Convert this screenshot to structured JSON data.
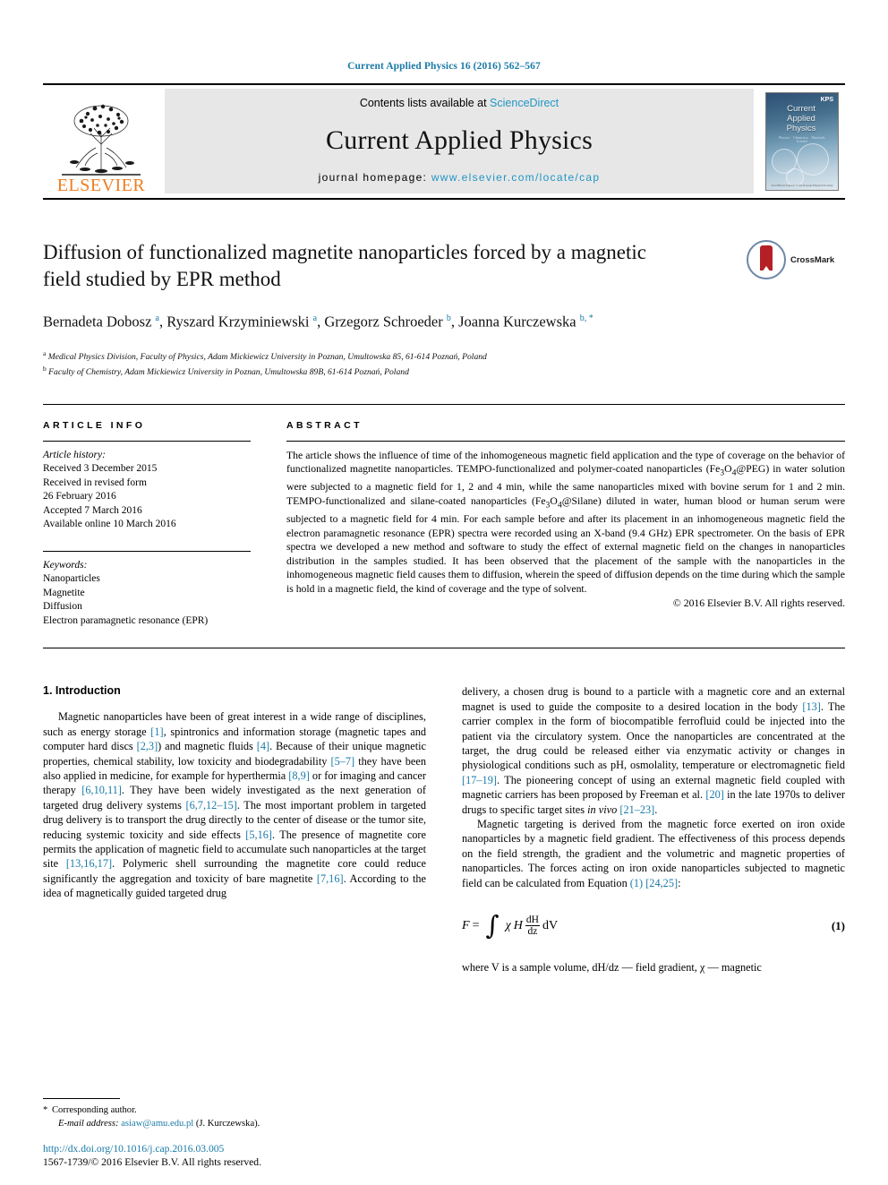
{
  "running_head": "Current Applied Physics 16 (2016) 562–567",
  "banner": {
    "publisher": "ELSEVIER",
    "contents_prefix": "Contents lists available at ",
    "contents_link": "ScienceDirect",
    "journal_name": "Current Applied Physics",
    "homepage_prefix": "journal homepage: ",
    "homepage_url": "www.elsevier.com/locate/cap",
    "cover": {
      "title_line1": "Current",
      "title_line2": "Applied",
      "title_line3": "Physics",
      "subtitle": "Physics · Chemistry · Materials Science",
      "society": "KPS",
      "footer": "An Official Journal of the Korean Physical Society"
    }
  },
  "article": {
    "title": "Diffusion of functionalized magnetite nanoparticles forced by a magnetic field studied by EPR method",
    "crossmark_label": "CrossMark",
    "authors_html": "Bernadeta Dobosz <sup>a</sup>, Ryszard Krzyminiewski <sup>a</sup>, Grzegorz Schroeder <sup>b</sup>, Joanna Kurczewska <sup>b, *</sup>",
    "affiliations": [
      "Medical Physics Division, Faculty of Physics, Adam Mickiewicz University in Poznan, Umultowska 85, 61-614 Poznań, Poland",
      "Faculty of Chemistry, Adam Mickiewicz University in Poznan, Umultowska 89B, 61-614 Poznań, Poland"
    ],
    "affil_marks": [
      "a",
      "b"
    ]
  },
  "info": {
    "heading": "ARTICLE INFO",
    "history_label": "Article history:",
    "history": [
      "Received 3 December 2015",
      "Received in revised form",
      "26 February 2016",
      "Accepted 7 March 2016",
      "Available online 10 March 2016"
    ],
    "keywords_label": "Keywords:",
    "keywords": [
      "Nanoparticles",
      "Magnetite",
      "Diffusion",
      "Electron paramagnetic resonance (EPR)"
    ]
  },
  "abstract": {
    "heading": "ABSTRACT",
    "text": "The article shows the influence of time of the inhomogeneous magnetic field application and the type of coverage on the behavior of functionalized magnetite nanoparticles. TEMPO-functionalized and polymer-coated nanoparticles (Fe3O4@PEG) in water solution were subjected to a magnetic field for 1, 2 and 4 min, while the same nanoparticles mixed with bovine serum for 1 and 2 min. TEMPO-functionalized and silane-coated nanoparticles (Fe3O4@Silane) diluted in water, human blood or human serum were subjected to a magnetic field for 4 min. For each sample before and after its placement in an inhomogeneous magnetic field the electron paramagnetic resonance (EPR) spectra were recorded using an X-band (9.4 GHz) EPR spectrometer. On the basis of EPR spectra we developed a new method and software to study the effect of external magnetic field on the changes in nanoparticles distribution in the samples studied. It has been observed that the placement of the sample with the nanoparticles in the inhomogeneous magnetic field causes them to diffusion, wherein the speed of diffusion depends on the time during which the sample is hold in a magnetic field, the kind of coverage and the type of solvent.",
    "copyright": "© 2016 Elsevier B.V. All rights reserved."
  },
  "body": {
    "section_number_title": "1. Introduction",
    "left_paragraph_1_html": "Magnetic nanoparticles have been of great interest in a wide range of disciplines, such as energy storage <span class=\"ref\">[1]</span>, spintronics and information storage (magnetic tapes and computer hard discs <span class=\"ref\">[2,3]</span>) and magnetic fluids <span class=\"ref\">[4]</span>. Because of their unique magnetic properties, chemical stability, low toxicity and biodegradability <span class=\"ref\">[5–7]</span> they have been also applied in medicine, for example for hyperthermia <span class=\"ref\">[8,9]</span> or for imaging and cancer therapy <span class=\"ref\">[6,10,11]</span>. They have been widely investigated as the next generation of targeted drug delivery systems <span class=\"ref\">[6,7,12–15]</span>. The most important problem in targeted drug delivery is to transport the drug directly to the center of disease or the tumor site, reducing systemic toxicity and side effects <span class=\"ref\">[5,16]</span>. The presence of magnetite core permits the application of magnetic field to accumulate such nanoparticles at the target site <span class=\"ref\">[13,16,17]</span>. Polymeric shell surrounding the magnetite core could reduce significantly the aggregation and toxicity of bare magnetite <span class=\"ref\">[7,16]</span>. According to the idea of magnetically guided targeted drug",
    "right_paragraph_1_html": "delivery, a chosen drug is bound to a particle with a magnetic core and an external magnet is used to guide the composite to a desired location in the body <span class=\"ref\">[13]</span>. The carrier complex in the form of biocompatible ferrofluid could be injected into the patient via the circulatory system. Once the nanoparticles are concentrated at the target, the drug could be released either via enzymatic activity or changes in physiological conditions such as pH, osmolality, temperature or electromagnetic field <span class=\"ref\">[17–19]</span>. The pioneering concept of using an external magnetic field coupled with magnetic carriers has been proposed by Freeman et al. <span class=\"ref\">[20]</span> in the late 1970s to deliver drugs to specific target sites <i>in vivo</i> <span class=\"ref\">[21–23]</span>.",
    "right_paragraph_2_html": "Magnetic targeting is derived from the magnetic force exerted on iron oxide nanoparticles by a magnetic field gradient. The effectiveness of this process depends on the field strength, the gradient and the volumetric and magnetic properties of nanoparticles. The forces acting on iron oxide nanoparticles subjected to magnetic field can be calculated from Equation <span class=\"ref\">(1) [24,25]</span>:",
    "equation": {
      "lhs": "F",
      "equals": "=",
      "integral": "∫",
      "chi": "χ",
      "H": "H",
      "numerator": "dH",
      "denominator": "dz",
      "differential": "dV",
      "number": "(1)"
    },
    "right_paragraph_3_html": "where V is a sample volume, dH/dz — field gradient, χ — magnetic"
  },
  "footnote": {
    "star": "*",
    "corresponding": "Corresponding author.",
    "email_label": "E-mail address:",
    "email": "asiaw@amu.edu.pl",
    "email_owner": "(J. Kurczewska)."
  },
  "footer": {
    "doi": "http://dx.doi.org/10.1016/j.cap.2016.03.005",
    "issn": "1567-1739/© 2016 Elsevier B.V. All rights reserved."
  },
  "colors": {
    "link": "#1a7aa8",
    "reference": "#1a7aa8",
    "elsevier_orange": "#ef7d22",
    "banner_gray": "#e7e7e7",
    "crossmark_red": "#b42025"
  }
}
